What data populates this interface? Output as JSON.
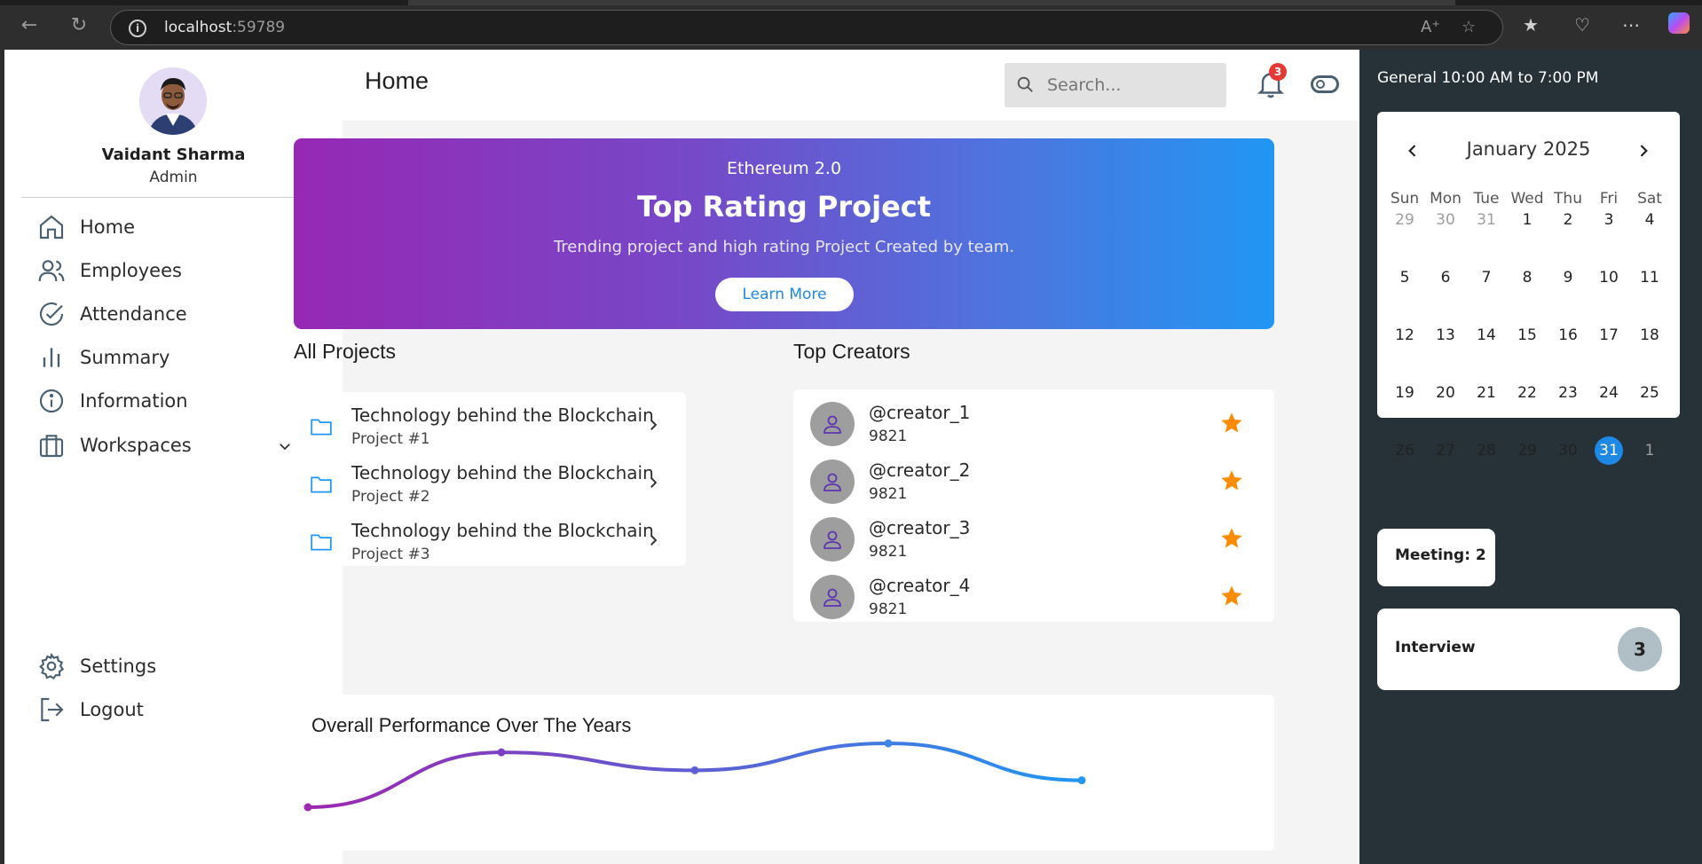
{
  "browser": {
    "url_host": "localhost",
    "url_port": ":59789"
  },
  "profile": {
    "name": "Vaidant Sharma",
    "role": "Admin"
  },
  "nav": {
    "items": [
      {
        "label": "Home",
        "icon": "home-icon"
      },
      {
        "label": "Employees",
        "icon": "users-icon"
      },
      {
        "label": "Attendance",
        "icon": "check-circle-icon"
      },
      {
        "label": "Summary",
        "icon": "bar-chart-icon"
      },
      {
        "label": "Information",
        "icon": "info-icon"
      },
      {
        "label": "Workspaces",
        "icon": "briefcase-icon"
      }
    ],
    "bottom": [
      {
        "label": "Settings",
        "icon": "gear-icon"
      },
      {
        "label": "Logout",
        "icon": "logout-icon"
      }
    ]
  },
  "header": {
    "title": "Home",
    "search_placeholder": "Search...",
    "notification_count": "3"
  },
  "hero": {
    "subtitle": "Ethereum 2.0",
    "title": "Top Rating Project",
    "description": "Trending project and high rating Project Created by team.",
    "button": "Learn More"
  },
  "projects": {
    "title": "All Projects",
    "items": [
      {
        "name": "Technology behind the Blockchain",
        "sub": "Project #1"
      },
      {
        "name": "Technology behind the Blockchain",
        "sub": "Project #2"
      },
      {
        "name": "Technology behind the Blockchain",
        "sub": "Project #3"
      }
    ]
  },
  "creators": {
    "title": "Top Creators",
    "items": [
      {
        "handle": "@creator_1",
        "score": "9821"
      },
      {
        "handle": "@creator_2",
        "score": "9821"
      },
      {
        "handle": "@creator_3",
        "score": "9821"
      },
      {
        "handle": "@creator_4",
        "score": "9821"
      }
    ]
  },
  "performance": {
    "title": "Overall Performance Over The Years",
    "chart_data": {
      "type": "line",
      "series": [
        {
          "values": [
            0,
            55,
            37,
            64,
            27
          ]
        }
      ],
      "colors": [
        "#9c27b0",
        "#2196f3"
      ]
    }
  },
  "schedule": {
    "text": "General 10:00 AM to 7:00 PM"
  },
  "calendar": {
    "month": "January 2025",
    "weekdays": [
      "Sun",
      "Mon",
      "Tue",
      "Wed",
      "Thu",
      "Fri",
      "Sat"
    ],
    "days": [
      [
        "29",
        "30",
        "31",
        "1",
        "2",
        "3",
        "4"
      ],
      [
        "5",
        "6",
        "7",
        "8",
        "9",
        "10",
        "11"
      ],
      [
        "12",
        "13",
        "14",
        "15",
        "16",
        "17",
        "18"
      ],
      [
        "19",
        "20",
        "21",
        "22",
        "23",
        "24",
        "25"
      ],
      [
        "26",
        "27",
        "28",
        "29",
        "30",
        "31",
        "1"
      ]
    ],
    "other_month": [
      [
        0,
        0
      ],
      [
        0,
        1
      ],
      [
        0,
        2
      ],
      [
        4,
        6
      ]
    ],
    "selected": [
      4,
      5
    ]
  },
  "events": {
    "meeting": "Meeting: 2",
    "interview_label": "Interview",
    "interview_count": "3"
  },
  "colors": {
    "accent": "#1e88e5",
    "panel": "#263238",
    "star": "#fb8c00"
  }
}
